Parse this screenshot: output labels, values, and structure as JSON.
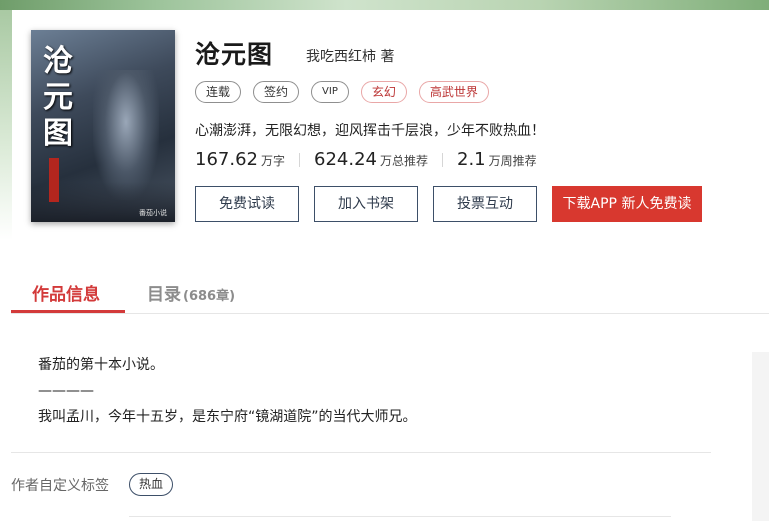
{
  "book": {
    "title": "沧元图",
    "author": "我吃西红柿 著",
    "cover": {
      "title": "沧元图",
      "brand": "番茄小说"
    },
    "tags": [
      "连载",
      "签约",
      "VIP",
      "玄幻",
      "高武世界"
    ],
    "slogan": "心潮澎湃，无限幻想，迎风挥击千层浪，少年不败热血！",
    "stats": [
      {
        "value": "167.62",
        "unit": "万字"
      },
      {
        "value": "624.24",
        "unit": "万总推荐"
      },
      {
        "value": "2.1",
        "unit": "万周推荐"
      }
    ]
  },
  "actions": {
    "free_read": "免费试读",
    "add_shelf": "加入书架",
    "vote": "投票互动",
    "download": "下载APP 新人免费读"
  },
  "tabs": {
    "info": "作品信息",
    "toc": "目录",
    "toc_count": "(686章)"
  },
  "description": [
    "番茄的第十本小说。",
    "————",
    "我叫孟川，今年十五岁，是东宁府“镜湖道院”的当代大师兄。"
  ],
  "custom_tags": {
    "label": "作者自定义标签",
    "items": [
      "热血"
    ]
  },
  "colors": {
    "accent_red": "#d8382f",
    "tab_active": "#d33a3a",
    "button_border": "#3d4f68"
  }
}
